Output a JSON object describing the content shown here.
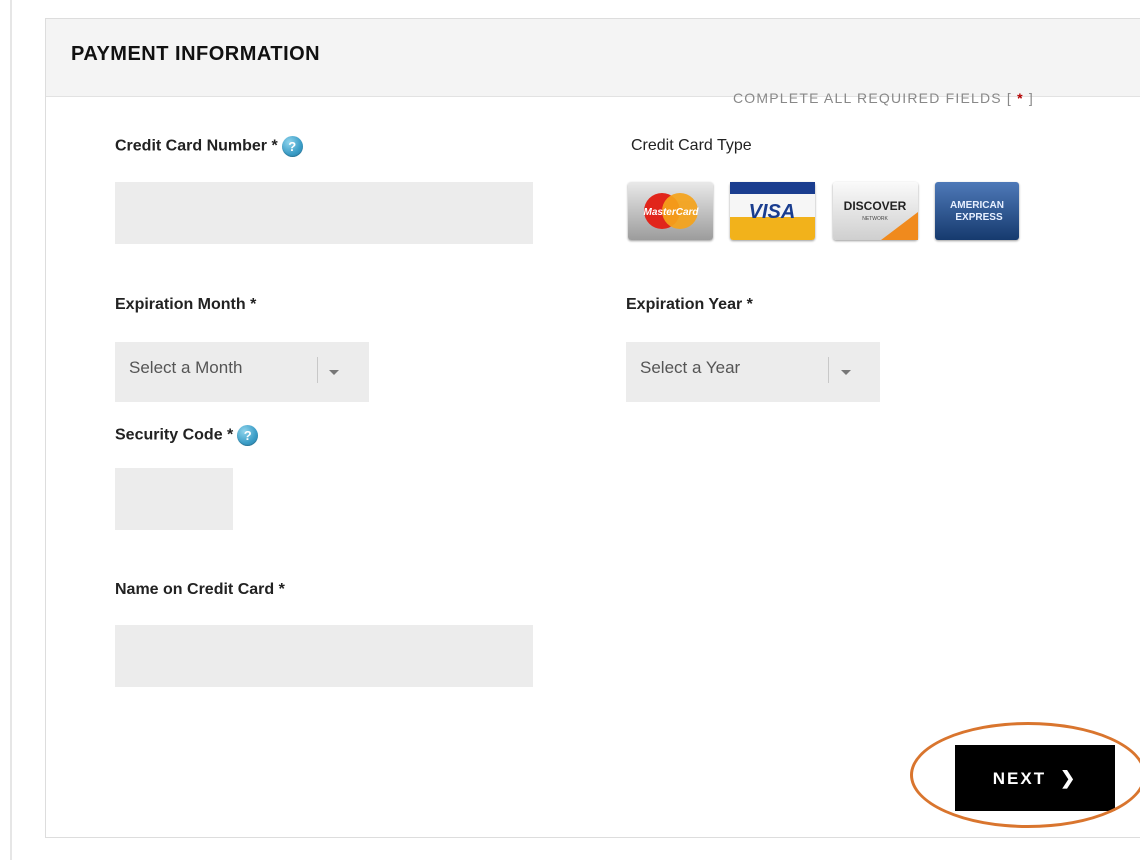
{
  "panel": {
    "title": "PAYMENT INFORMATION"
  },
  "required_note": {
    "text": "COMPLETE ALL REQUIRED FIELDS [ ",
    "star": "*",
    "close": " ]"
  },
  "fields": {
    "cc_number": {
      "label": "Credit Card Number *",
      "value": ""
    },
    "cc_type": {
      "label": "Credit Card Type"
    },
    "exp_month": {
      "label": "Expiration Month *",
      "selected": "Select a Month"
    },
    "exp_year": {
      "label": "Expiration Year *",
      "selected": "Select a Year"
    },
    "security_code": {
      "label": "Security Code *",
      "value": ""
    },
    "name_on_card": {
      "label": "Name on Credit Card *",
      "value": ""
    }
  },
  "help_icon_glyph": "?",
  "cards": [
    {
      "name": "mastercard",
      "label": "MasterCard"
    },
    {
      "name": "visa",
      "label": "VISA"
    },
    {
      "name": "discover",
      "label": "DISCOVER",
      "sub": "NETWORK"
    },
    {
      "name": "amex",
      "label": "AMERICAN",
      "sub": "EXPRESS"
    }
  ],
  "next_button": {
    "label": "NEXT",
    "icon": "chevron-right-icon",
    "chevron": "❯"
  },
  "colors": {
    "highlight": "#d9752e",
    "help_icon": "#3a9cc6",
    "input_bg": "#ececec",
    "button_bg": "#000000"
  }
}
